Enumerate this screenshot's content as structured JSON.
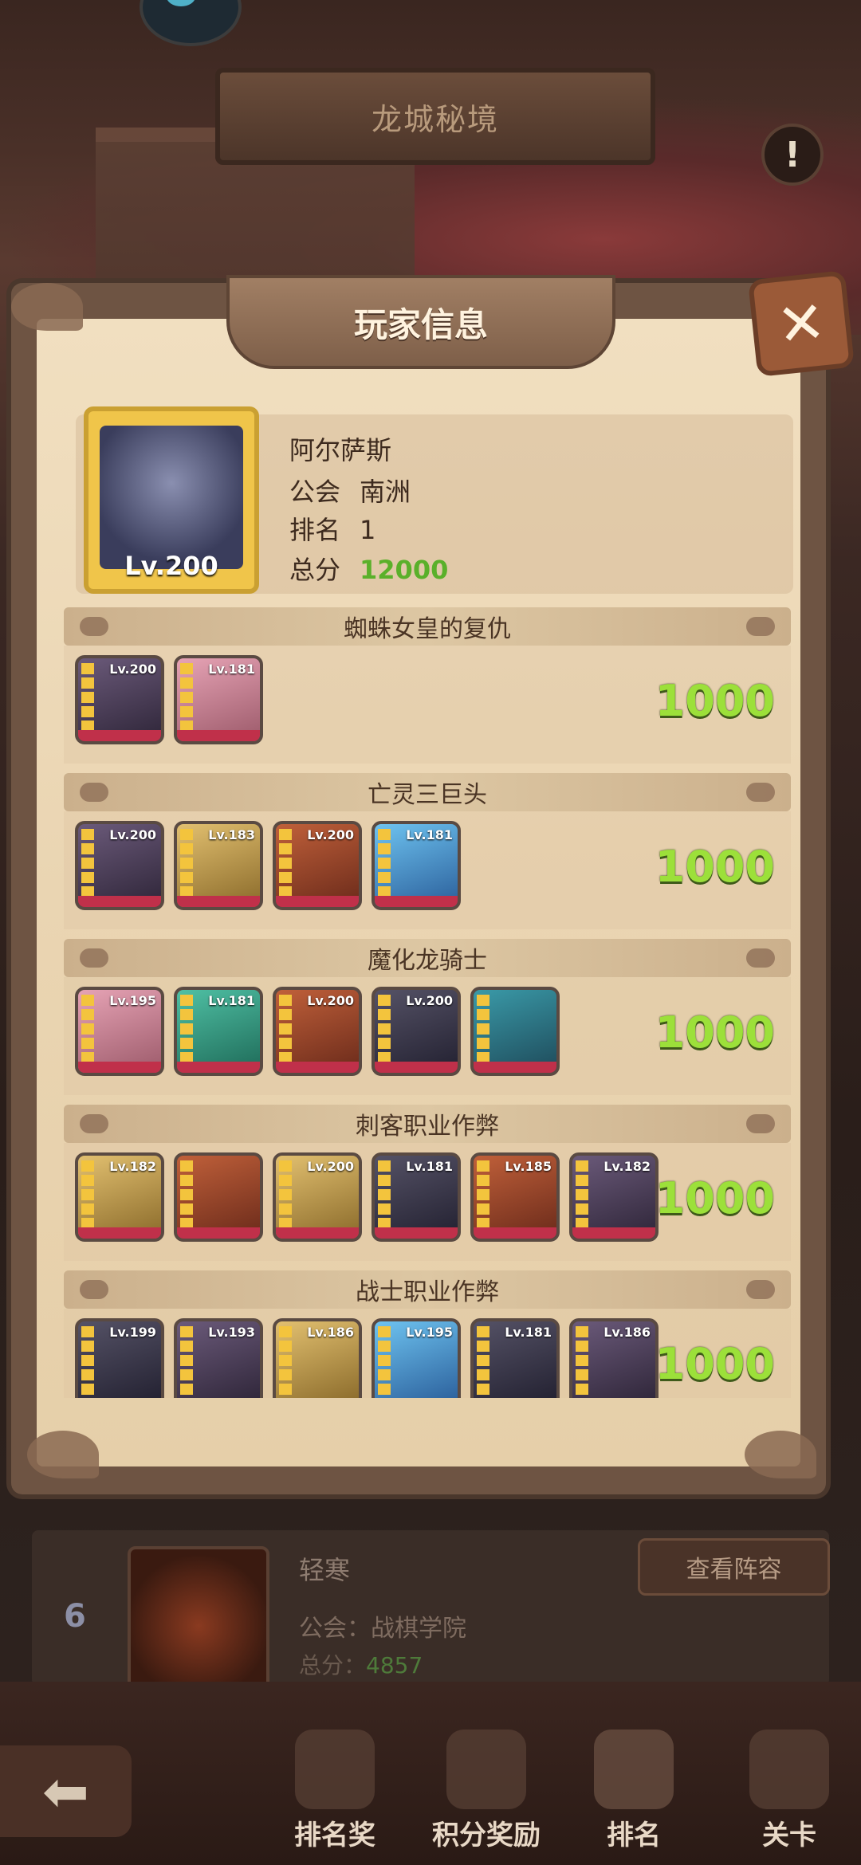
{
  "header": {
    "title": "龙城秘境",
    "info_icon": "!"
  },
  "modal": {
    "title": "玩家信息",
    "close_icon": "✕",
    "player": {
      "name": "阿尔萨斯",
      "level": "Lv.200",
      "guild_label": "公会",
      "guild": "南洲",
      "rank_label": "排名",
      "rank": "1",
      "score_label": "总分",
      "score": "12000"
    },
    "sections": [
      {
        "title": "蜘蛛女皇的复仇",
        "score": "1000",
        "heroes": [
          "Lv.200",
          "Lv.181"
        ]
      },
      {
        "title": "亡灵三巨头",
        "score": "1000",
        "heroes": [
          "Lv.200",
          "Lv.183",
          "Lv.200",
          "Lv.181"
        ]
      },
      {
        "title": "魔化龙骑士",
        "score": "1000",
        "heroes": [
          "Lv.195",
          "Lv.181",
          "Lv.200",
          "Lv.200",
          ""
        ]
      },
      {
        "title": "刺客职业作弊",
        "score": "1000",
        "heroes": [
          "Lv.182",
          "",
          "Lv.200",
          "Lv.181",
          "Lv.185",
          "Lv.182"
        ]
      },
      {
        "title": "战士职业作弊",
        "score": "1000",
        "heroes": [
          "Lv.199",
          "Lv.193",
          "Lv.186",
          "Lv.195",
          "Lv.181",
          "Lv.186"
        ]
      }
    ]
  },
  "list": {
    "rank": "6",
    "name": "轻寒",
    "guild": "公会：战棋学院",
    "score_label": "总分：",
    "score": "4857",
    "view_button": "查看阵容"
  },
  "nav": {
    "back": "⬅",
    "items": [
      "排名奖",
      "积分奖励",
      "排名",
      "关卡"
    ]
  }
}
